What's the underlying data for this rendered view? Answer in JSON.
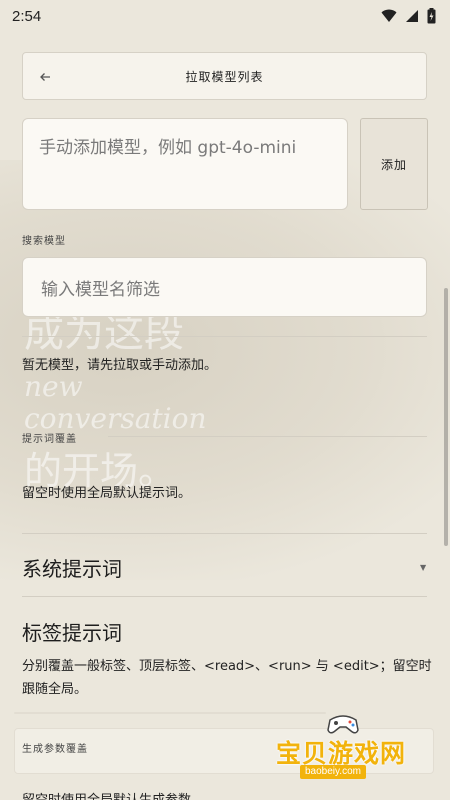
{
  "status_bar": {
    "time": "2:54",
    "icons": [
      "wifi-icon",
      "signal-icon",
      "battery-icon"
    ]
  },
  "header": {
    "back_icon": "arrow-left-icon",
    "title": "拉取模型列表"
  },
  "add_model": {
    "placeholder": "手动添加模型，例如 gpt-4o-mini",
    "button_label": "添加"
  },
  "search": {
    "label": "搜索模型",
    "placeholder": "输入模型名筛选"
  },
  "empty_message": "暂无模型，请先拉取或手动添加。",
  "prompt_override": {
    "label": "提示词覆盖",
    "description": "留空时使用全局默认提示词。"
  },
  "system_prompt": {
    "title": "系统提示词",
    "arrow_icon": "triangle-down-icon"
  },
  "tag_prompt": {
    "title": "标签提示词",
    "note": "分别覆盖一般标签、顶层标签、<read>、<run> 与 <edit>；留空时跟随全局。"
  },
  "generation_override": {
    "label": "生成参数覆盖",
    "description": "留空时使用全局默认生成参数"
  },
  "watermark": {
    "text": "宝贝游戏网",
    "url": "baobeiy.com"
  },
  "colors": {
    "background": "#ebe7dc",
    "card": "#fbf9f4",
    "border": "#d6d1c6",
    "watermark": "#f2b30c"
  }
}
